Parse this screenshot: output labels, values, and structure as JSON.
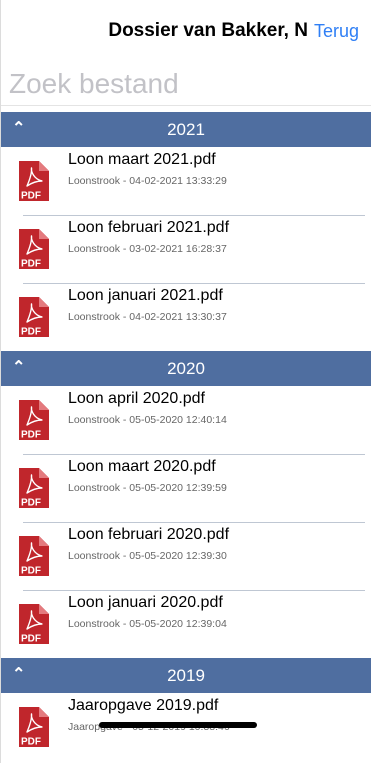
{
  "header": {
    "title": "Dossier van Bakker, N",
    "back_label": "Terug"
  },
  "search": {
    "placeholder": "Zoek bestand",
    "value": ""
  },
  "icons": {
    "section_toggle": "chevron-up-icon",
    "file": "pdf-file-icon",
    "file_badge": "PDF"
  },
  "colors": {
    "section_header": "#4f6ea0",
    "link": "#2f7ff5",
    "pdf_red": "#c0262c"
  },
  "sections": [
    {
      "year": "2021",
      "files": [
        {
          "name": "Loon maart 2021.pdf",
          "meta": "Loonstrook -  04-02-2021 13:33:29"
        },
        {
          "name": "Loon februari 2021.pdf",
          "meta": "Loonstrook -  03-02-2021 16:28:37"
        },
        {
          "name": "Loon januari 2021.pdf",
          "meta": "Loonstrook -  04-02-2021 13:30:37"
        }
      ]
    },
    {
      "year": "2020",
      "files": [
        {
          "name": "Loon april 2020.pdf",
          "meta": "Loonstrook -  05-05-2020 12:40:14"
        },
        {
          "name": "Loon maart 2020.pdf",
          "meta": "Loonstrook -  05-05-2020 12:39:59"
        },
        {
          "name": "Loon februari 2020.pdf",
          "meta": "Loonstrook -  05-05-2020 12:39:30"
        },
        {
          "name": "Loon januari 2020.pdf",
          "meta": "Loonstrook -  05-05-2020 12:39:04"
        }
      ]
    },
    {
      "year": "2019",
      "files": [
        {
          "name": "Jaaropgave 2019.pdf",
          "meta": "Jaaropgave -  05-12-2019 10:38:46",
          "redacted": true
        }
      ]
    }
  ]
}
